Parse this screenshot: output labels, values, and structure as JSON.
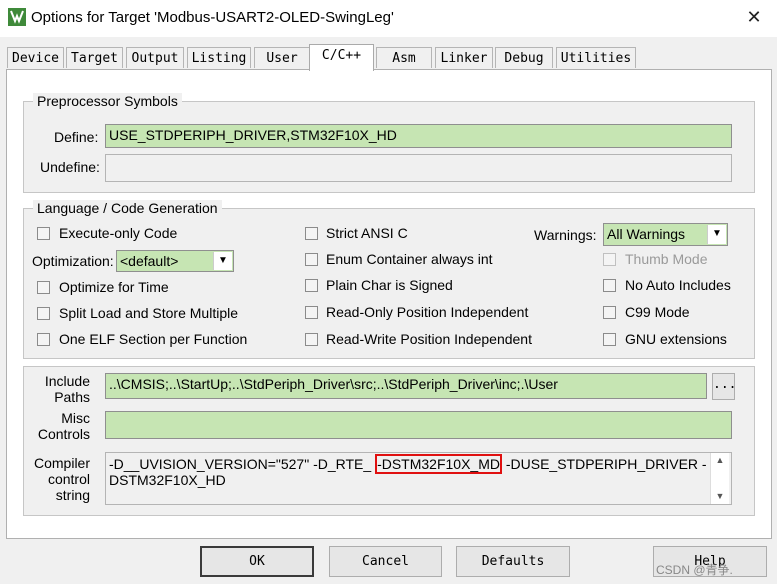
{
  "window": {
    "title": "Options for Target 'Modbus-USART2-OLED-SwingLeg'"
  },
  "tabs": [
    {
      "label": "Device"
    },
    {
      "label": "Target"
    },
    {
      "label": "Output"
    },
    {
      "label": "Listing"
    },
    {
      "label": "User"
    },
    {
      "label": "C/C++"
    },
    {
      "label": "Asm"
    },
    {
      "label": "Linker"
    },
    {
      "label": "Debug"
    },
    {
      "label": "Utilities"
    }
  ],
  "active_tab": "C/C++",
  "preprocessor": {
    "group_title": "Preprocessor Symbols",
    "define_label": "Define:",
    "define_value": "USE_STDPERIPH_DRIVER,STM32F10X_HD",
    "undefine_label": "Undefine:",
    "undefine_value": ""
  },
  "language": {
    "group_title": "Language / Code Generation",
    "execute_only": "Execute-only Code",
    "optimization_label": "Optimization:",
    "optimization_value": "<default>",
    "optimize_time": "Optimize for Time",
    "split_load": "Split Load and Store Multiple",
    "one_elf": "One ELF Section per Function",
    "strict_ansi": "Strict ANSI C",
    "enum_container": "Enum Container always int",
    "plain_char": "Plain Char is Signed",
    "ro_pi": "Read-Only Position Independent",
    "rw_pi": "Read-Write Position Independent",
    "warnings_label": "Warnings:",
    "warnings_value": "All Warnings",
    "thumb_mode": "Thumb Mode",
    "no_auto_includes": "No Auto Includes",
    "c99_mode": "C99 Mode",
    "gnu_ext": "GNU extensions"
  },
  "include": {
    "label_line1": "Include",
    "label_line2": "Paths",
    "value": "..\\CMSIS;..\\StartUp;..\\StdPeriph_Driver\\src;..\\StdPeriph_Driver\\inc;.\\User",
    "browse_label": "..."
  },
  "misc": {
    "label_line1": "Misc",
    "label_line2": "Controls",
    "value": ""
  },
  "compiler": {
    "label_line1": "Compiler",
    "label_line2": "control",
    "label_line3": "string",
    "part1": "-D__UVISION_VERSION=\"527\" -D_RTE_ ",
    "highlight": "-DSTM32F10X_MD",
    "part2": " -DUSE_STDPERIPH_DRIVER -",
    "line2": "DSTM32F10X_HD"
  },
  "buttons": {
    "ok": "OK",
    "cancel": "Cancel",
    "defaults": "Defaults",
    "help": "Help"
  },
  "watermark": "CSDN @青争."
}
